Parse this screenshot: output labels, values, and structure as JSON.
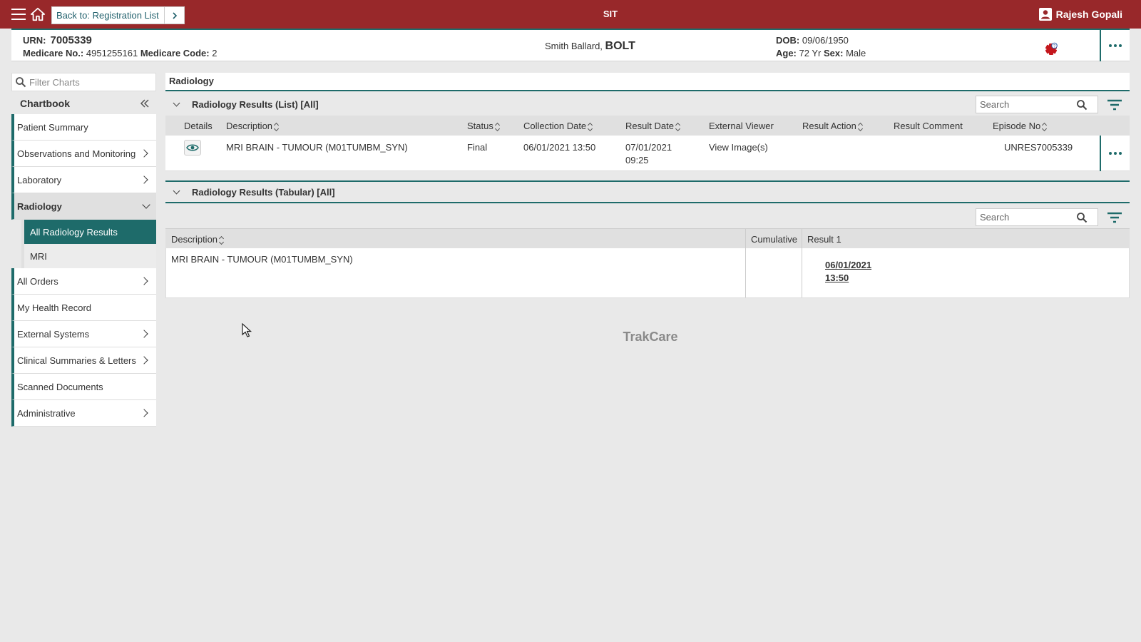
{
  "topbar": {
    "back_label": "Back to: Registration List",
    "env": "SIT",
    "user_name": "Rajesh Gopali",
    "colors": {
      "bar": "#98282a",
      "accent": "#1e6b6a"
    }
  },
  "patient": {
    "urn_label": "URN:",
    "urn": "7005339",
    "medicare_no_label": "Medicare No.:",
    "medicare_no": "4951255161",
    "medicare_code_label": "Medicare Code:",
    "medicare_code": "2",
    "given_names": "Smith Ballard,",
    "surname": "BOLT",
    "dob_label": "DOB:",
    "dob": "09/06/1950",
    "age_label": "Age:",
    "age": "72 Yr",
    "sex_label": "Sex:",
    "sex": "Male"
  },
  "sidebar": {
    "filter_placeholder": "Filter Charts",
    "chartbook_label": "Chartbook",
    "items": [
      {
        "label": "Patient Summary"
      },
      {
        "label": "Observations and Monitoring"
      },
      {
        "label": "Laboratory"
      },
      {
        "label": "Radiology"
      },
      {
        "label": "All Orders"
      },
      {
        "label": "My Health Record"
      },
      {
        "label": "External Systems"
      },
      {
        "label": "Clinical Summaries & Letters"
      },
      {
        "label": "Scanned Documents"
      },
      {
        "label": "Administrative"
      }
    ],
    "radiology_sub": [
      {
        "label": "All Radiology Results"
      },
      {
        "label": "MRI"
      }
    ]
  },
  "main": {
    "title": "Radiology",
    "list_section": {
      "title": "Radiology Results (List) [All]",
      "search_placeholder": "Search",
      "columns": [
        "Details",
        "Description",
        "Status",
        "Collection Date",
        "Result Date",
        "External Viewer",
        "Result Action",
        "Result Comment",
        "Episode No"
      ],
      "row": {
        "description": "MRI BRAIN - TUMOUR (M01TUMBM_SYN)",
        "status": "Final",
        "collection_date": "06/01/2021 13:50",
        "result_date_line1": "07/01/2021",
        "result_date_line2": "09:25",
        "external_viewer": "View Image(s)",
        "episode_no": "UNRES7005339"
      }
    },
    "tabular_section": {
      "title": "Radiology Results (Tabular) [All]",
      "search_placeholder": "Search",
      "columns": [
        "Description",
        "Cumulative",
        "Result 1"
      ],
      "row": {
        "description": "MRI BRAIN - TUMOUR (M01TUMBM_SYN)",
        "result_date_line1": "06/01/2021",
        "result_date_line2": "13:50"
      }
    },
    "footer_brand": "TrakCare"
  }
}
